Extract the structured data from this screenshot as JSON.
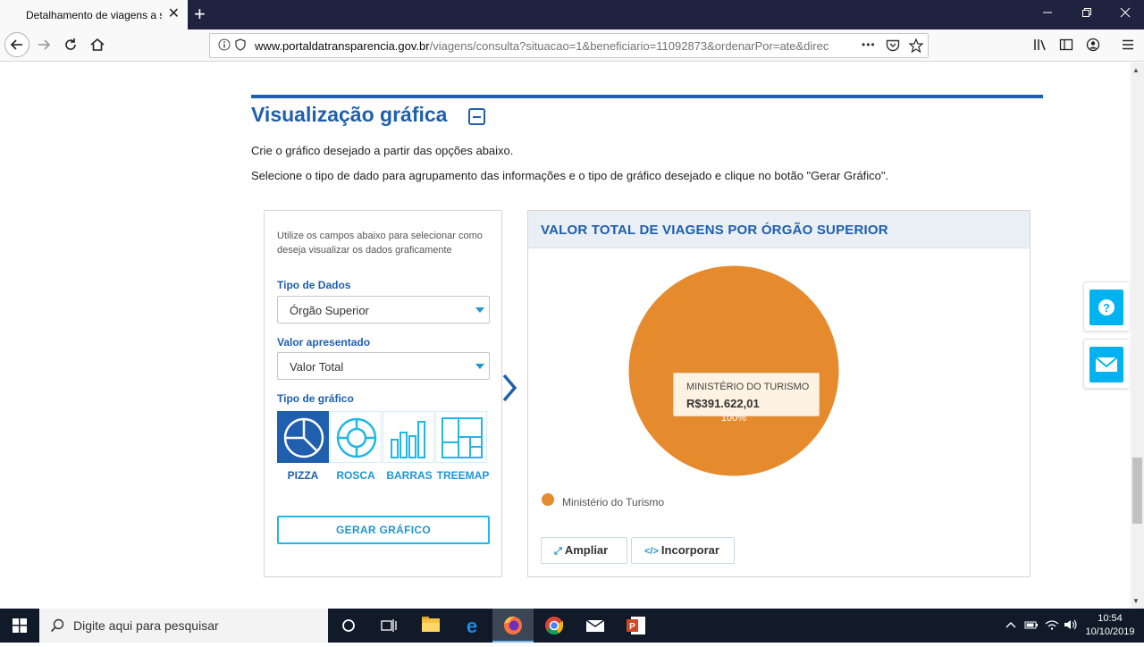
{
  "browser": {
    "tab_title": "Detalhamento de viagens a ser",
    "url_host": "www.portaldatransparencia.gov.br",
    "url_path": "/viagens/consulta?situacao=1&beneficiario=11092873&ordenarPor=ate&direc",
    "new_tab_label": "+",
    "tab_close": "✕",
    "more_label": "•••"
  },
  "section": {
    "title": "Visualização gráfica",
    "intro_1": "Crie o gráfico desejado a partir das opções abaixo.",
    "intro_2": "Selecione o tipo de dado para agrupamento das informações e o tipo de gráfico desejado e clique no botão \"Gerar Gráfico\"."
  },
  "options": {
    "help": "Utilize os campos abaixo para selecionar como deseja visualizar os dados graficamente",
    "tipo_dados_label": "Tipo de Dados",
    "tipo_dados_value": "Órgão Superior",
    "valor_label": "Valor apresentado",
    "valor_value": "Valor Total",
    "tipo_grafico_label": "Tipo de gráfico",
    "chart_types": [
      {
        "label": "PIZZA",
        "icon": "pie-chart-icon",
        "selected": true
      },
      {
        "label": "ROSCA",
        "icon": "donut-chart-icon",
        "selected": false
      },
      {
        "label": "BARRAS",
        "icon": "bar-chart-icon",
        "selected": false
      },
      {
        "label": "TREEMAP",
        "icon": "treemap-icon",
        "selected": false
      }
    ],
    "generate_label": "GERAR GRÁFICO"
  },
  "chart_panel": {
    "title": "VALOR TOTAL DE VIAGENS POR ÓRGÃO SUPERIOR",
    "tooltip_name": "MINISTÉRIO DO TURISMO",
    "tooltip_value": "R$391.622,01",
    "percent_label": "100%",
    "legend_label": "Ministério do Turismo",
    "expand_label": "Ampliar",
    "embed_label": "Incorporar",
    "colors": {
      "slice": "#e68a2e",
      "accent": "#1f5fad",
      "light_accent": "#1f96d3"
    }
  },
  "chart_data": {
    "type": "pie",
    "title": "VALOR TOTAL DE VIAGENS POR ÓRGÃO SUPERIOR",
    "categories": [
      "Ministério do Turismo"
    ],
    "values": [
      391622.01
    ],
    "percentages": [
      100
    ],
    "colors": [
      "#e68a2e"
    ],
    "legend": "bottom-left"
  },
  "taskbar": {
    "search_placeholder": "Digite aqui para pesquisar",
    "time": "10:54",
    "date": "10/10/2019"
  }
}
